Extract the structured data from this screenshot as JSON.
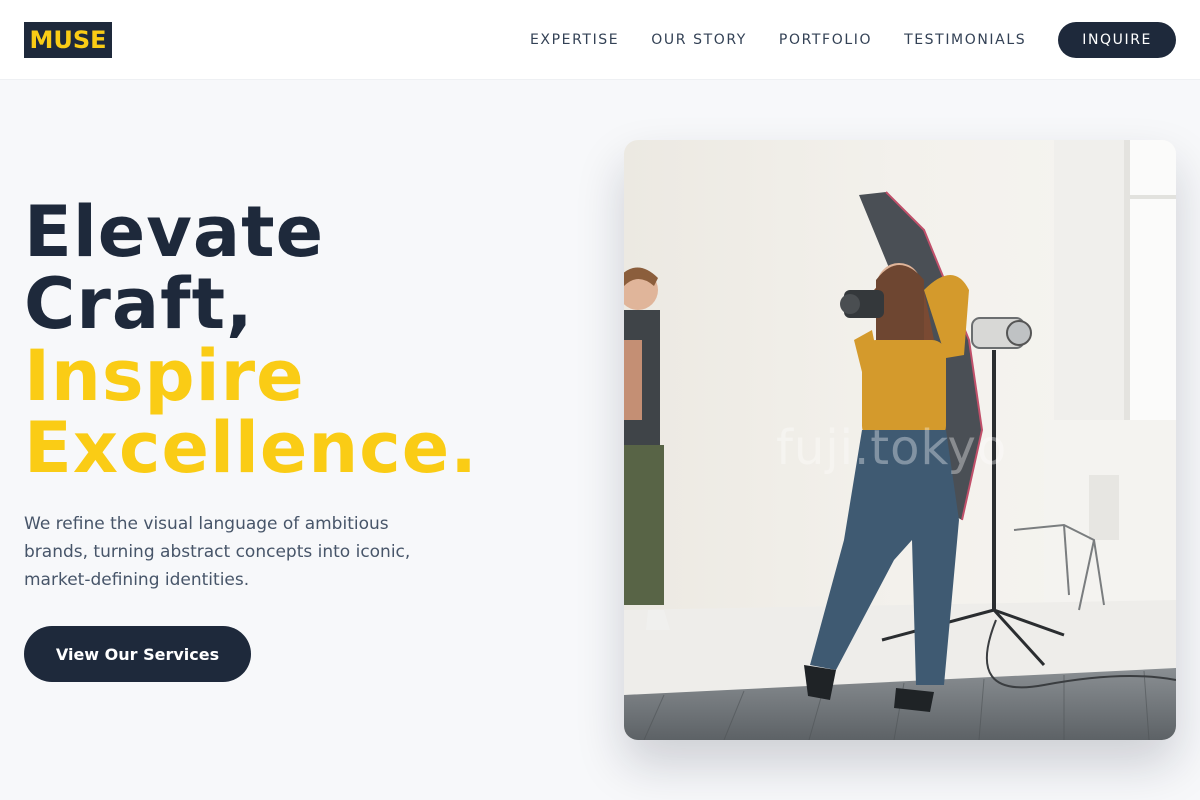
{
  "brand": {
    "logo_text": "MUSE",
    "colors": {
      "primary": "#1e293b",
      "accent": "#facc15",
      "background": "#f7f8fa"
    }
  },
  "nav": {
    "links": [
      "EXPERTISE",
      "OUR STORY",
      "PORTFOLIO",
      "TESTIMONIALS"
    ],
    "cta_label": "INQUIRE"
  },
  "hero": {
    "title_line1": "Elevate",
    "title_line2": "Craft,",
    "title_line3": "Inspire",
    "title_line4": "Excellence.",
    "description": "We refine the visual language of ambitious brands, turning abstract concepts into iconic, market-defining identities.",
    "cta_label": "View Our Services"
  },
  "image": {
    "watermark": "fuji.tokyo"
  }
}
